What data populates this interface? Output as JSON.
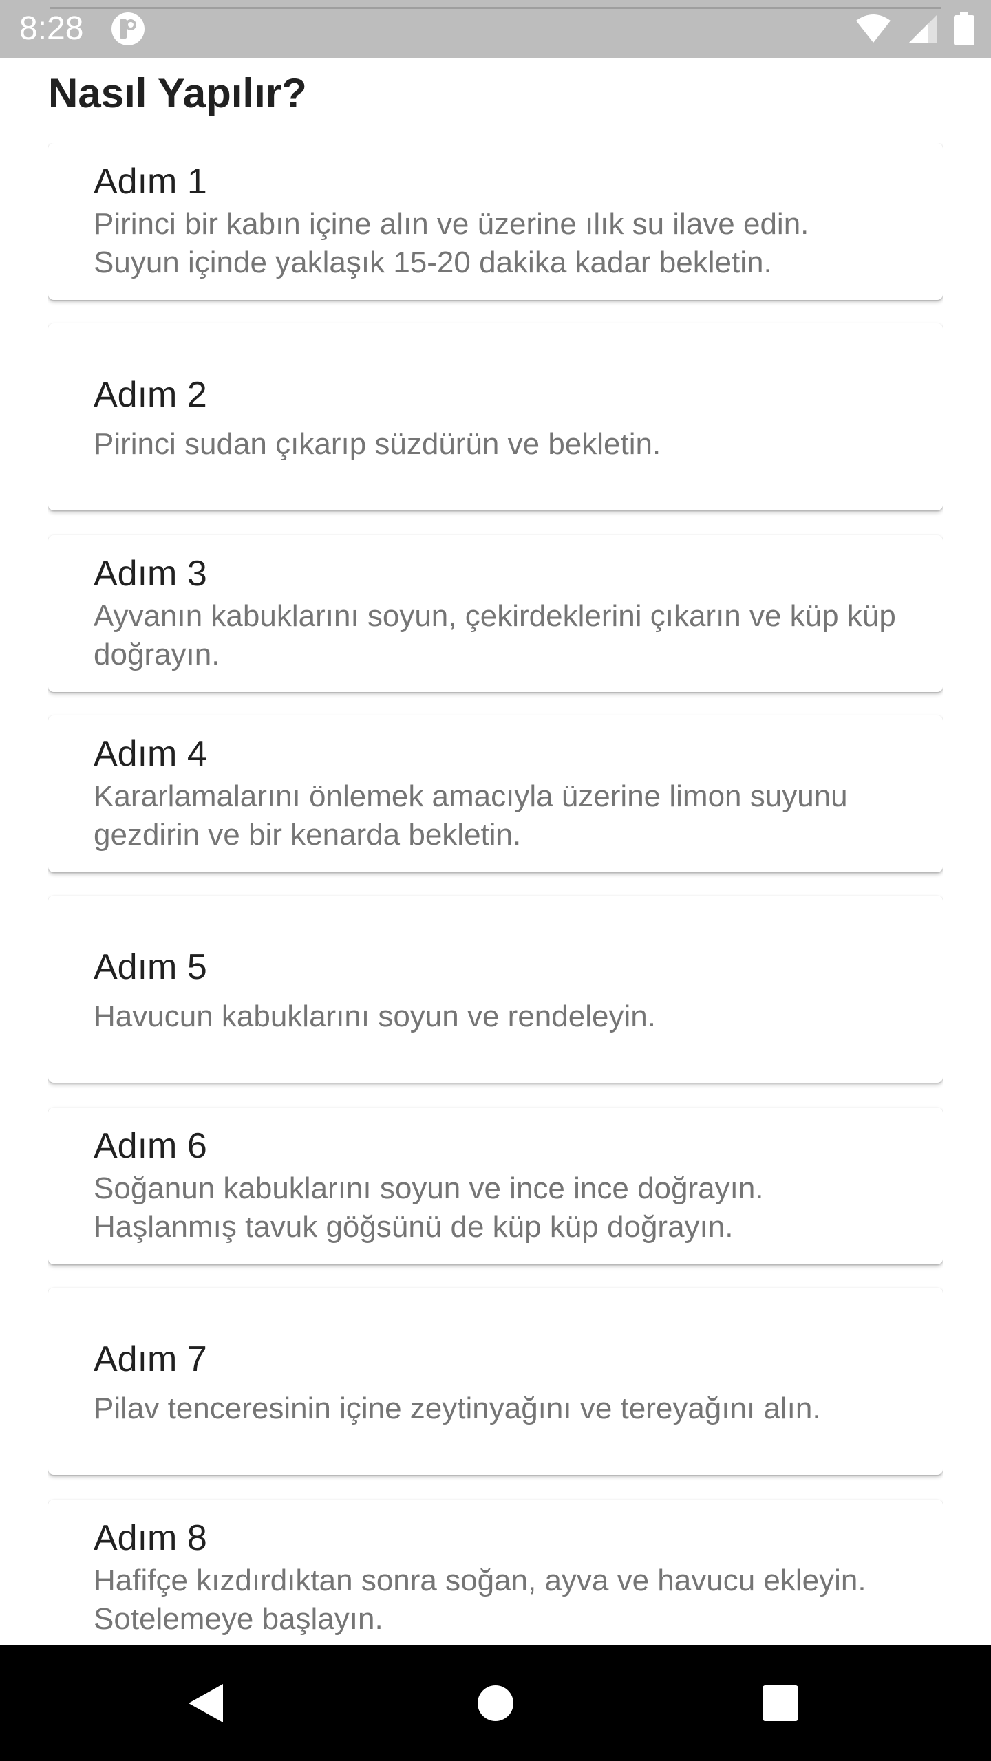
{
  "status_bar": {
    "time": "8:28",
    "icons": [
      "app-notification-icon",
      "wifi-icon",
      "cell-signal-icon",
      "battery-icon"
    ]
  },
  "page": {
    "title": "Nasıl Yapılır?"
  },
  "steps": [
    {
      "title": "Adım 1",
      "desc": "Pirinci bir kabın içine alın ve üzerine ılık su ilave edin. Suyun içinde yaklaşık 15-20 dakika kadar bekletin."
    },
    {
      "title": "Adım 2",
      "desc": "Pirinci sudan çıkarıp süzdürün ve bekletin."
    },
    {
      "title": "Adım 3",
      "desc": "Ayvanın kabuklarını soyun, çekirdeklerini çıkarın ve küp küp doğrayın."
    },
    {
      "title": "Adım 4",
      "desc": "Kararlamalarını önlemek amacıyla üzerine limon suyunu gezdirin ve bir kenarda bekletin."
    },
    {
      "title": "Adım 5",
      "desc": "Havucun kabuklarını soyun ve rendeleyin."
    },
    {
      "title": "Adım 6",
      "desc": "Soğanun kabuklarını soyun ve ince ince doğrayın. Haşlanmış tavuk göğsünü de küp küp doğrayın."
    },
    {
      "title": "Adım 7",
      "desc": "Pilav tenceresinin içine zeytinyağını ve tereyağını alın."
    },
    {
      "title": "Adım 8",
      "desc": "Hafifçe kızdırdıktan sonra soğan, ayva ve havucu ekleyin. Sotelemeye başlayın."
    }
  ],
  "nav_bar": {
    "icons": [
      "back-icon",
      "home-icon",
      "recents-icon"
    ]
  }
}
